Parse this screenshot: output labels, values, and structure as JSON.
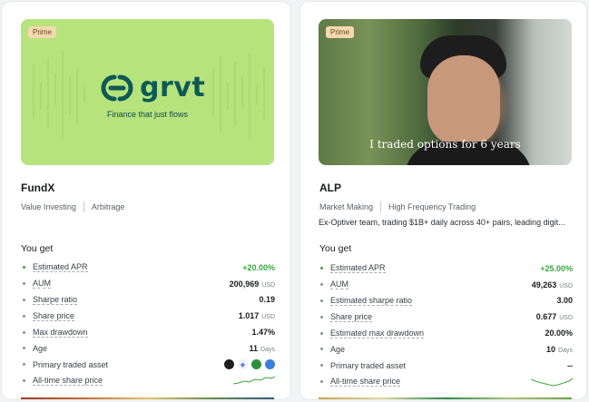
{
  "cards": [
    {
      "badge": "Prime",
      "hero": {
        "logo_text": "grvt",
        "tagline": "Finance that just flows"
      },
      "name": "FundX",
      "tags": [
        "Value Investing",
        "Arbitrage"
      ],
      "description": "",
      "you_get": "You get",
      "stats": {
        "apr": {
          "label": "Estimated APR",
          "value": "+20.00%"
        },
        "aum": {
          "label": "AUM",
          "value": "200,969",
          "unit": "USD"
        },
        "sharpe": {
          "label": "Sharpe ratio",
          "value": "0.19"
        },
        "share_price": {
          "label": "Share price",
          "value": "1.017",
          "unit": "USD"
        },
        "drawdown": {
          "label": "Max drawdown",
          "value": "1.47%"
        },
        "age": {
          "label": "Age",
          "value": "11",
          "unit": "Days"
        },
        "assets": {
          "label": "Primary traded asset"
        },
        "history": {
          "label": "All-time share price"
        }
      }
    },
    {
      "badge": "Prime",
      "hero": {
        "caption": "I traded options for 6 years"
      },
      "name": "ALP",
      "tags": [
        "Market Making",
        "High Frequency Trading"
      ],
      "description": "Ex-Optiver team, trading $1B+ daily across 40+ pairs, leading digit...",
      "you_get": "You get",
      "stats": {
        "apr": {
          "label": "Estimated APR",
          "value": "+25.00%"
        },
        "aum": {
          "label": "AUM",
          "value": "49,263",
          "unit": "USD"
        },
        "sharpe": {
          "label": "Estimated sharpe ratio",
          "value": "3.00"
        },
        "share_price": {
          "label": "Share price",
          "value": "0.677",
          "unit": "USD"
        },
        "drawdown": {
          "label": "Estimated max drawdown",
          "value": "20.00%"
        },
        "age": {
          "label": "Age",
          "value": "10",
          "unit": "Days"
        },
        "assets": {
          "label": "Primary traded asset",
          "value": "--"
        },
        "history": {
          "label": "All-time share price"
        }
      }
    }
  ],
  "colors": {
    "accent_green": "#3aa640",
    "hero_green": "#b7e37d",
    "logo_teal": "#0d5a55",
    "badge_bg": "#f3d8b0"
  },
  "icons": [
    "grvt-logo-icon",
    "black-coin-icon",
    "eth-coin-icon",
    "green-coin-icon",
    "blue-coin-icon",
    "sparkline-icon"
  ]
}
